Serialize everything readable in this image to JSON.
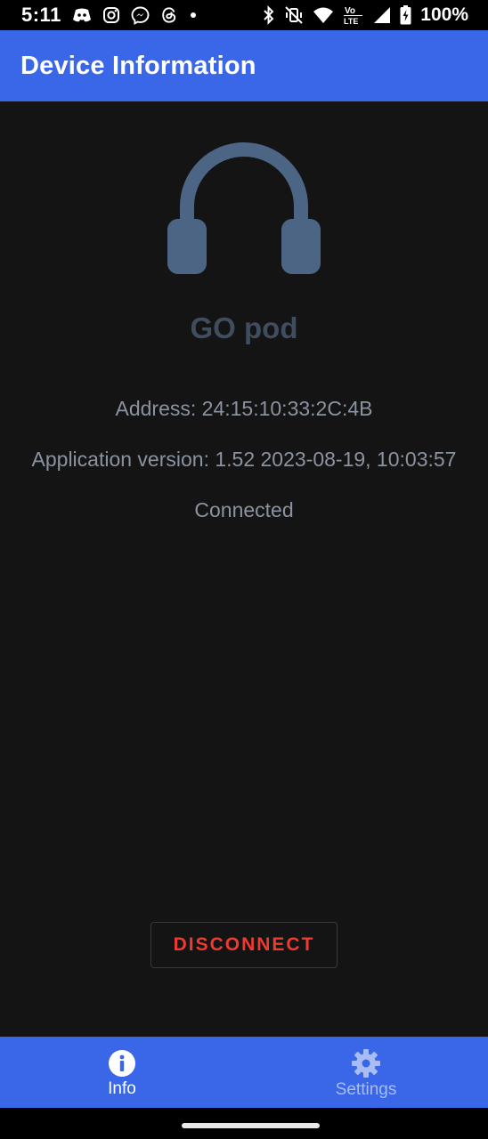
{
  "status_bar": {
    "time": "5:11",
    "battery_percent": "100%",
    "left_icons": [
      "discord-icon",
      "instagram-icon",
      "messenger-icon",
      "threads-icon",
      "dot-icon"
    ],
    "right_icons": [
      "bluetooth-icon",
      "vibrate-off-icon",
      "wifi-icon",
      "volte-icon",
      "signal-icon",
      "battery-charging-icon"
    ]
  },
  "app_bar": {
    "title": "Device Information"
  },
  "device": {
    "icon": "headphones-icon",
    "name": "GO pod",
    "address": "Address: 24:15:10:33:2C:4B",
    "version": "Application version: 1.52  2023-08-19, 10:03:57",
    "status": "Connected"
  },
  "actions": {
    "disconnect_label": "DISCONNECT"
  },
  "bottom_nav": {
    "items": [
      {
        "label": "Info",
        "icon": "info-icon",
        "active": true
      },
      {
        "label": "Settings",
        "icon": "gear-icon",
        "active": false
      }
    ]
  },
  "colors": {
    "app_bar": "#3a67e8",
    "background": "#141414",
    "headphone": "#4c6584",
    "device_name": "#3f4d5e",
    "info_text": "#8b93a0",
    "disconnect_text": "#ee3b30"
  }
}
